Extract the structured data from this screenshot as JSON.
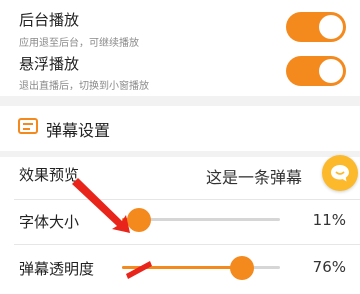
{
  "settings": {
    "background_play": {
      "title": "后台播放",
      "subtitle": "应用退至后台，可继续播放",
      "enabled": true
    },
    "float_play": {
      "title": "悬浮播放",
      "subtitle": "退出直播后，切换到小窗播放",
      "enabled": true
    }
  },
  "danmaku": {
    "section_title": "弹幕设置",
    "preview": {
      "label": "效果预览",
      "text": "这是一条弹幕"
    },
    "font_size": {
      "label": "字体大小",
      "value_text": "11%",
      "value": 0.11
    },
    "opacity": {
      "label": "弹幕透明度",
      "value_text": "76%",
      "value": 0.76
    }
  },
  "colors": {
    "accent": "#f4891e",
    "fab": "#fbb92b",
    "annotation_arrow": "#e8241b"
  },
  "icons": {
    "section": "danmaku-icon",
    "fab": "chat-bubble-icon"
  }
}
